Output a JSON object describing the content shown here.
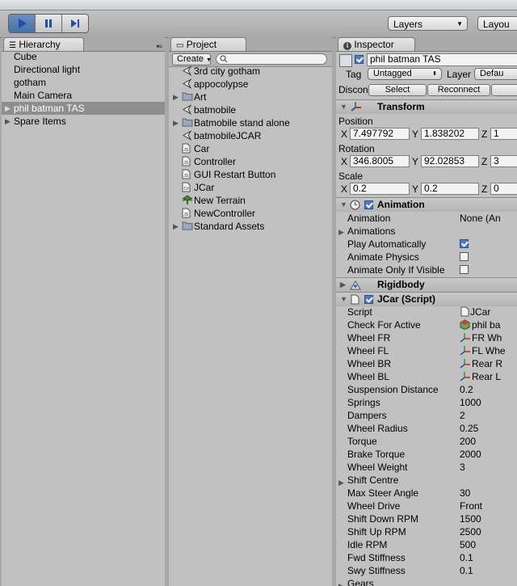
{
  "toolbar": {
    "layers_label": "Layers",
    "layout_label": "Layou"
  },
  "hierarchy": {
    "tab": "Hierarchy",
    "items": [
      {
        "label": "Cube"
      },
      {
        "label": "Directional light"
      },
      {
        "label": "gotham"
      },
      {
        "label": "Main Camera"
      },
      {
        "label": "phil batman TAS"
      },
      {
        "label": "Spare Items"
      }
    ]
  },
  "project": {
    "tab": "Project",
    "create_label": "Create",
    "search_placeholder": "",
    "items": [
      {
        "label": "3rd city gotham",
        "icon": "unity-scene-icon"
      },
      {
        "label": "appocolypse",
        "icon": "unity-scene-icon"
      },
      {
        "label": "Art",
        "icon": "folder-icon"
      },
      {
        "label": "batmobile",
        "icon": "unity-scene-icon"
      },
      {
        "label": "Batmobile stand alone",
        "icon": "folder-icon"
      },
      {
        "label": "batmobileJCAR",
        "icon": "unity-scene-icon"
      },
      {
        "label": "Car",
        "icon": "js-script-icon"
      },
      {
        "label": "Controller",
        "icon": "js-script-icon"
      },
      {
        "label": "GUI Restart Button",
        "icon": "js-script-icon"
      },
      {
        "label": "JCar",
        "icon": "cs-script-icon"
      },
      {
        "label": "New Terrain",
        "icon": "terrain-icon"
      },
      {
        "label": "NewController",
        "icon": "js-script-icon"
      },
      {
        "label": "Standard Assets",
        "icon": "folder-icon"
      }
    ]
  },
  "inspector": {
    "tab": "Inspector",
    "object_name": "phil batman TAS",
    "tag_label": "Tag",
    "tag_value": "Untagged",
    "layer_label": "Layer",
    "layer_value": "Defau",
    "prefab_label": "Discon",
    "select_label": "Select",
    "reconnect_label": "Reconnect",
    "transform": {
      "title": "Transform",
      "position_label": "Position",
      "rotation_label": "Rotation",
      "scale_label": "Scale",
      "x": "X",
      "y": "Y",
      "z": "Z",
      "pos_x": "7.497792",
      "pos_y": "1.838202",
      "pos_z": "1",
      "rot_x": "346.8005",
      "rot_y": "92.02853",
      "rot_z": "3",
      "scale_x": "0.2",
      "scale_y": "0.2",
      "scale_z": "0"
    },
    "animation": {
      "title": "Animation",
      "rows": [
        {
          "label": "Animation",
          "value": "None (An"
        },
        {
          "label": "Animations",
          "value": ""
        },
        {
          "label": "Play Automatically",
          "value": ""
        },
        {
          "label": "Animate Physics",
          "value": ""
        },
        {
          "label": "Animate Only If Visible",
          "value": ""
        }
      ]
    },
    "rigidbody_title": "Rigidbody",
    "jcar": {
      "title": "JCar (Script)",
      "rows": [
        {
          "label": "Script",
          "value": "JCar"
        },
        {
          "label": "Check For Active",
          "value": "phil ba"
        },
        {
          "label": "Wheel FR",
          "value": "FR Wh"
        },
        {
          "label": "Wheel FL",
          "value": "FL Whe"
        },
        {
          "label": "Wheel BR",
          "value": "Rear R"
        },
        {
          "label": "Wheel BL",
          "value": "Rear L"
        },
        {
          "label": "Suspension Distance",
          "value": "0.2"
        },
        {
          "label": "Springs",
          "value": "1000"
        },
        {
          "label": "Dampers",
          "value": "2"
        },
        {
          "label": "Wheel Radius",
          "value": "0.25"
        },
        {
          "label": "Torque",
          "value": "200"
        },
        {
          "label": "Brake Torque",
          "value": "2000"
        },
        {
          "label": "Wheel Weight",
          "value": "3"
        },
        {
          "label": "Shift Centre",
          "value": ""
        },
        {
          "label": "Max Steer Angle",
          "value": "30"
        },
        {
          "label": "Wheel Drive",
          "value": "Front"
        },
        {
          "label": "Shift Down RPM",
          "value": "1500"
        },
        {
          "label": "Shift Up RPM",
          "value": "2500"
        },
        {
          "label": "Idle RPM",
          "value": "500"
        },
        {
          "label": "Fwd Stiffness",
          "value": "0.1"
        },
        {
          "label": "Swy Stiffness",
          "value": "0.1"
        },
        {
          "label": "Gears",
          "value": ""
        }
      ]
    }
  }
}
